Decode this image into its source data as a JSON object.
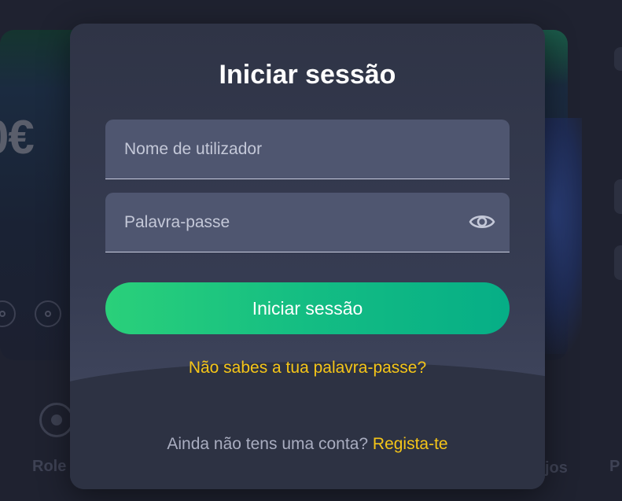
{
  "background": {
    "promo_amount": "0€",
    "category_left_label": "Role",
    "category_right_label": "jos",
    "category_far_right_label": "P"
  },
  "login_modal": {
    "title": "Iniciar sessão",
    "username_placeholder": "Nome de utilizador",
    "password_placeholder": "Palavra-passe",
    "show_password_icon": "eye-icon",
    "login_button_label": "Iniciar sessão",
    "forgot_password_link": "Não sabes a tua palavra-passe?",
    "signup_prompt": "Ainda não tens uma conta?",
    "signup_link": "Regista-te"
  },
  "colors": {
    "accent_green_start": "#2ad07a",
    "accent_green_end": "#06ae86",
    "link_yellow": "#f5c518",
    "modal_bg": "#363c52",
    "field_bg": "#4f5670"
  }
}
